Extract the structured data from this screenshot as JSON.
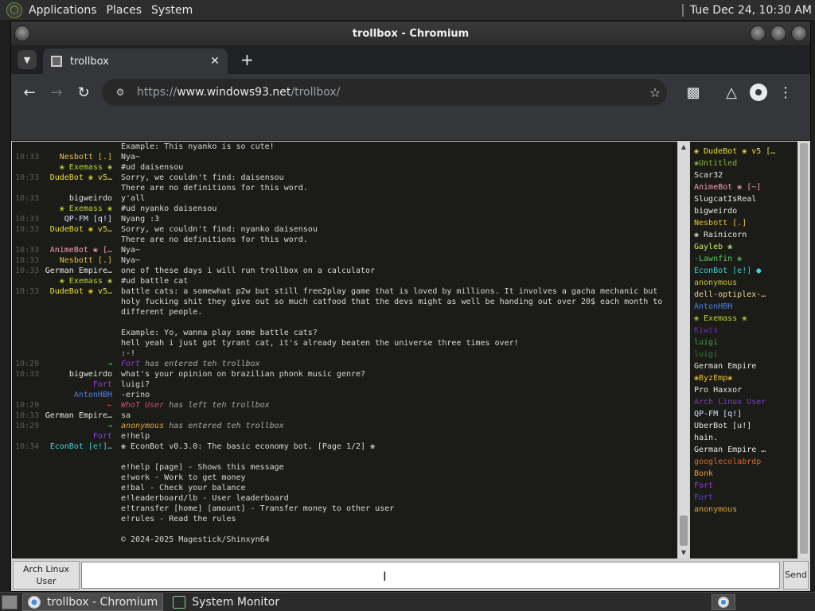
{
  "top_panel": {
    "menus": [
      "Applications",
      "Places",
      "System"
    ],
    "clock": "Tue Dec 24, 10:30 AM"
  },
  "window": {
    "title": "trollbox - Chromium"
  },
  "browser": {
    "tab_title": "trollbox",
    "url_scheme": "https://",
    "url_host": "www.windows93.net",
    "url_path": "/trollbox/"
  },
  "chat": {
    "messages": [
      {
        "time": "",
        "nick": "",
        "nick_color": "#dadad2",
        "text": "Example: This nyanko is so cute!"
      },
      {
        "time": "10:33",
        "nick": "Nesbott [.]",
        "nick_color": "#e8c23a",
        "text": "Nya~"
      },
      {
        "time": "",
        "nick": "❀ Exemass ❀",
        "nick_color": "#b7d534",
        "text": "#ud daisensou"
      },
      {
        "time": "10:33",
        "nick": "DudeBot ❀ v5…",
        "nick_color": "#e8e03a",
        "text": "Sorry, we couldn't find: daisensou"
      },
      {
        "time": "",
        "nick": "",
        "nick_color": "#dadad2",
        "text": "There are no definitions for this word."
      },
      {
        "time": "10:33",
        "nick": "bigweirdo",
        "nick_color": "#e6e6e6",
        "text": "y'all"
      },
      {
        "time": "",
        "nick": "❀ Exemass ❀",
        "nick_color": "#b7d534",
        "text": "#ud nyanko daisensou"
      },
      {
        "time": "10:33",
        "nick": "QP-FM [q!]",
        "nick_color": "#d6e0ff",
        "text": "Nyang :3"
      },
      {
        "time": "10:33",
        "nick": "DudeBot ❀ v5…",
        "nick_color": "#e8e03a",
        "text": "Sorry, we couldn't find: nyanko daisensou"
      },
      {
        "time": "",
        "nick": "",
        "nick_color": "#dadad2",
        "text": "There are no definitions for this word."
      },
      {
        "time": "10:33",
        "nick": "AnimeBot ❀ […",
        "nick_color": "#f2a0b8",
        "text": "Nya~"
      },
      {
        "time": "10:33",
        "nick": "Nesbott [.]",
        "nick_color": "#e8c23a",
        "text": "Nya~"
      },
      {
        "time": "10:33",
        "nick": "German Empire…",
        "nick_color": "#e6e6e6",
        "text": "one of these days i will run trollbox on a calculator"
      },
      {
        "time": "",
        "nick": "❀ Exemass ❀",
        "nick_color": "#b7d534",
        "text": "#ud battle cat"
      },
      {
        "time": "10:33",
        "nick": "DudeBot ❀ v5…",
        "nick_color": "#e8e03a",
        "text": "battle cats: a somewhat p2w but still free2play game that is loved by millions. It involves a gacha mechanic but"
      },
      {
        "time": "",
        "nick": "",
        "nick_color": "#dadad2",
        "text": "holy fucking shit they give out so much catfood that the devs might as well be handing out over 20$ each month to"
      },
      {
        "time": "",
        "nick": "",
        "nick_color": "#dadad2",
        "text": "different people."
      },
      {
        "time": "",
        "nick": "",
        "nick_color": "#dadad2",
        "text": ""
      },
      {
        "time": "",
        "nick": "",
        "nick_color": "#dadad2",
        "text": "Example: Yo, wanna play some battle cats?"
      },
      {
        "time": "",
        "nick": "",
        "nick_color": "#dadad2",
        "text": "hell yeah i just got tyrant cat, it's already beaten the universe three times over!"
      },
      {
        "time": "",
        "nick": "",
        "nick_color": "#dadad2",
        "text": ":-!"
      },
      {
        "time": "10:29",
        "nick": "→",
        "nick_color": "#3fc93f",
        "text": "has entered teh trollbox",
        "system": true,
        "who": "Fort",
        "who_color": "#8b3fd8"
      },
      {
        "time": "10:33",
        "nick": "bigweirdo",
        "nick_color": "#e6e6e6",
        "text": "what's your opinion on brazilian phonk music genre?"
      },
      {
        "time": "",
        "nick": "Fort",
        "nick_color": "#8b3fd8",
        "text": "luigi?"
      },
      {
        "time": "",
        "nick": "AntonHBH",
        "nick_color": "#4d7fe8",
        "text": "-erino"
      },
      {
        "time": "10:29",
        "nick": "←",
        "nick_color": "#d83f3f",
        "text": "has left teh trollbox",
        "system": true,
        "who": "WhoT User",
        "who_color": "#d8477a"
      },
      {
        "time": "10:33",
        "nick": "German Empire…",
        "nick_color": "#e6e6e6",
        "text": "sa"
      },
      {
        "time": "10:29",
        "nick": "→",
        "nick_color": "#3fc93f",
        "text": "has entered teh trollbox",
        "system": true,
        "who": "anonymous",
        "who_color": "#d8a83f"
      },
      {
        "time": "",
        "nick": "Fort",
        "nick_color": "#8b3fd8",
        "text": "e!help"
      },
      {
        "time": "10:34",
        "nick": "EconBot [e!]…",
        "nick_color": "#3fd0d0",
        "text": "❀ EconBot v0.3.0: The basic economy bot. [Page 1/2] ❀"
      },
      {
        "time": "",
        "nick": "",
        "nick_color": "#dadad2",
        "text": ""
      },
      {
        "time": "",
        "nick": "",
        "nick_color": "#dadad2",
        "text": "e!help [page] - Shows this message"
      },
      {
        "time": "",
        "nick": "",
        "nick_color": "#dadad2",
        "text": "e!work - Work to get money"
      },
      {
        "time": "",
        "nick": "",
        "nick_color": "#dadad2",
        "text": "e!bal - Check your balance"
      },
      {
        "time": "",
        "nick": "",
        "nick_color": "#dadad2",
        "text": "e!leaderboard/lb - User leaderboard"
      },
      {
        "time": "",
        "nick": "",
        "nick_color": "#dadad2",
        "text": "e!transfer [home] [amount] - Transfer money to other user"
      },
      {
        "time": "",
        "nick": "",
        "nick_color": "#dadad2",
        "text": "e!rules - Read the rules"
      },
      {
        "time": "",
        "nick": "",
        "nick_color": "#dadad2",
        "text": ""
      },
      {
        "time": "",
        "nick": "",
        "nick_color": "#dadad2",
        "text": "© 2024-2025 Magestick/Shinxyn64"
      }
    ]
  },
  "users": [
    {
      "name": "❀ DudeBot ❀ v5 […",
      "color": "#e8e03a"
    },
    {
      "name": "❀Untitled",
      "color": "#8ab83a"
    },
    {
      "name": "Scar32",
      "color": "#e6e6e6"
    },
    {
      "name": "AnimeBot ❀ [~]",
      "color": "#f2a0b8"
    },
    {
      "name": "SlugcatIsReal",
      "color": "#e6e6e6"
    },
    {
      "name": "bigweirdo",
      "color": "#e6e6e6"
    },
    {
      "name": "Nesbott [.]",
      "color": "#e8c23a"
    },
    {
      "name": "❀ Rainicorn",
      "color": "#e6e6e6"
    },
    {
      "name": "Gayleb ❀",
      "color": "#c8f05a"
    },
    {
      "name": "-Lawnfin ❀",
      "color": "#5ac85a"
    },
    {
      "name": "EconBot [e!] ●",
      "color": "#3fd0d0"
    },
    {
      "name": "anonymous",
      "color": "#c8c83a"
    },
    {
      "name": "dell-optiplex-…",
      "color": "#e6d690"
    },
    {
      "name": "AntonHBH",
      "color": "#4d7fe8"
    },
    {
      "name": "❀ Exemass ❀",
      "color": "#b7d534"
    },
    {
      "name": "Kiwix",
      "color": "#6a2fb8"
    },
    {
      "name": "luigi",
      "color": "#3fa03f"
    },
    {
      "name": "luigi",
      "color": "#2d7f2d"
    },
    {
      "name": "German Empire",
      "color": "#e6e6e6"
    },
    {
      "name": "❀ByzEmp❀",
      "color": "#e8c23a"
    },
    {
      "name": "Pro Haxxor",
      "color": "#e6e6e6"
    },
    {
      "name": "Arch Linux User",
      "color": "#7a3fc8"
    },
    {
      "name": "QP-FM [q!]",
      "color": "#d6e0ff"
    },
    {
      "name": "UberBot [u!]",
      "color": "#e6e6e6"
    },
    {
      "name": "hain.",
      "color": "#e6e6e6"
    },
    {
      "name": "German Empire …",
      "color": "#e6e6e6"
    },
    {
      "name": "googlecolabrdp",
      "color": "#d86a2f"
    },
    {
      "name": "Bonk",
      "color": "#e89a3a"
    },
    {
      "name": "Fort",
      "color": "#8b3fd8"
    },
    {
      "name": "Fort",
      "color": "#6a3fd8"
    },
    {
      "name": "anonymous",
      "color": "#d8a83f"
    }
  ],
  "input": {
    "nick_button": "Arch Linux User",
    "send_button": "Send"
  },
  "taskbar": {
    "tasks": [
      "trollbox - Chromium",
      "System Monitor"
    ]
  }
}
